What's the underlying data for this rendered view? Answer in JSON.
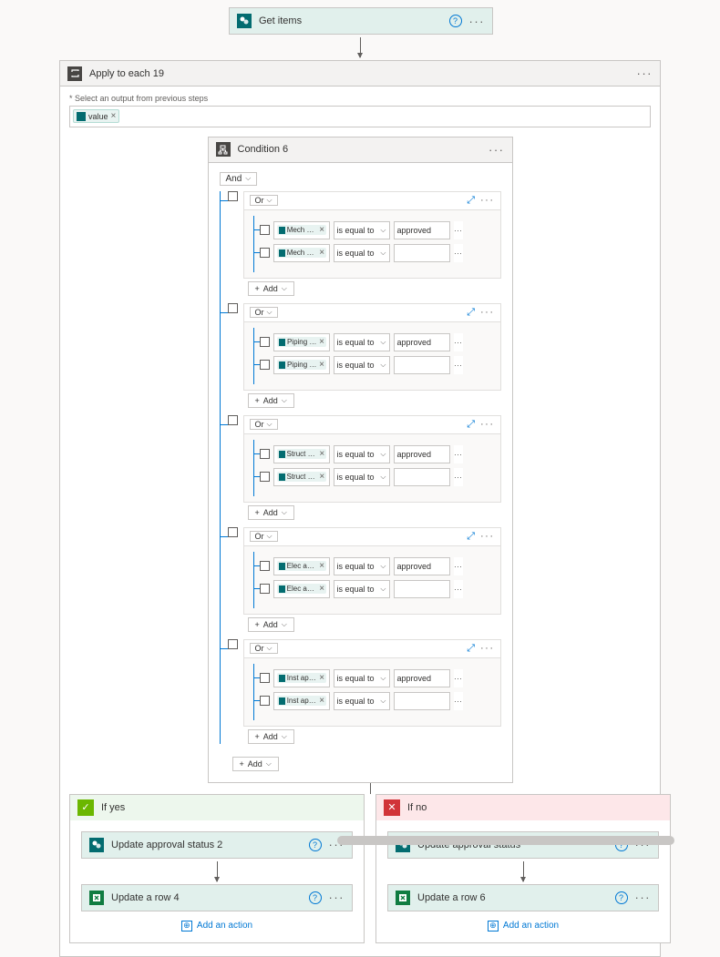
{
  "top_action": {
    "title": "Get items"
  },
  "apply_each": {
    "title": "Apply to each 19",
    "input_label": "* Select an output from previous steps",
    "token": "value"
  },
  "condition": {
    "title": "Condition 6",
    "outer_op": "And",
    "inner_op": "Or",
    "add_label": "Add",
    "groups": [
      {
        "rows": [
          {
            "field": "Mech ap...",
            "op": "is equal to",
            "val": "approved"
          },
          {
            "field": "Mech ap...",
            "op": "is equal to",
            "val": ""
          }
        ]
      },
      {
        "rows": [
          {
            "field": "Piping a...",
            "op": "is equal to",
            "val": "approved"
          },
          {
            "field": "Piping a...",
            "op": "is equal to",
            "val": ""
          }
        ]
      },
      {
        "rows": [
          {
            "field": "Struct ap...",
            "op": "is equal to",
            "val": "approved"
          },
          {
            "field": "Struct ap...",
            "op": "is equal to",
            "val": ""
          }
        ]
      },
      {
        "rows": [
          {
            "field": "Elec app...",
            "op": "is equal to",
            "val": "approved"
          },
          {
            "field": "Elec app...",
            "op": "is equal to",
            "val": ""
          }
        ]
      },
      {
        "rows": [
          {
            "field": "Inst appr...",
            "op": "is equal to",
            "val": "approved"
          },
          {
            "field": "Inst appr...",
            "op": "is equal to",
            "val": ""
          }
        ]
      }
    ]
  },
  "yes": {
    "label": "If yes",
    "actions": [
      {
        "icon": "sp",
        "title": "Update approval status 2"
      },
      {
        "icon": "xl",
        "title": "Update a row 4"
      }
    ]
  },
  "no": {
    "label": "If no",
    "actions": [
      {
        "icon": "sp",
        "title": "Update approval status"
      },
      {
        "icon": "xl",
        "title": "Update a row 6"
      }
    ]
  },
  "add_action_label": "Add an action"
}
